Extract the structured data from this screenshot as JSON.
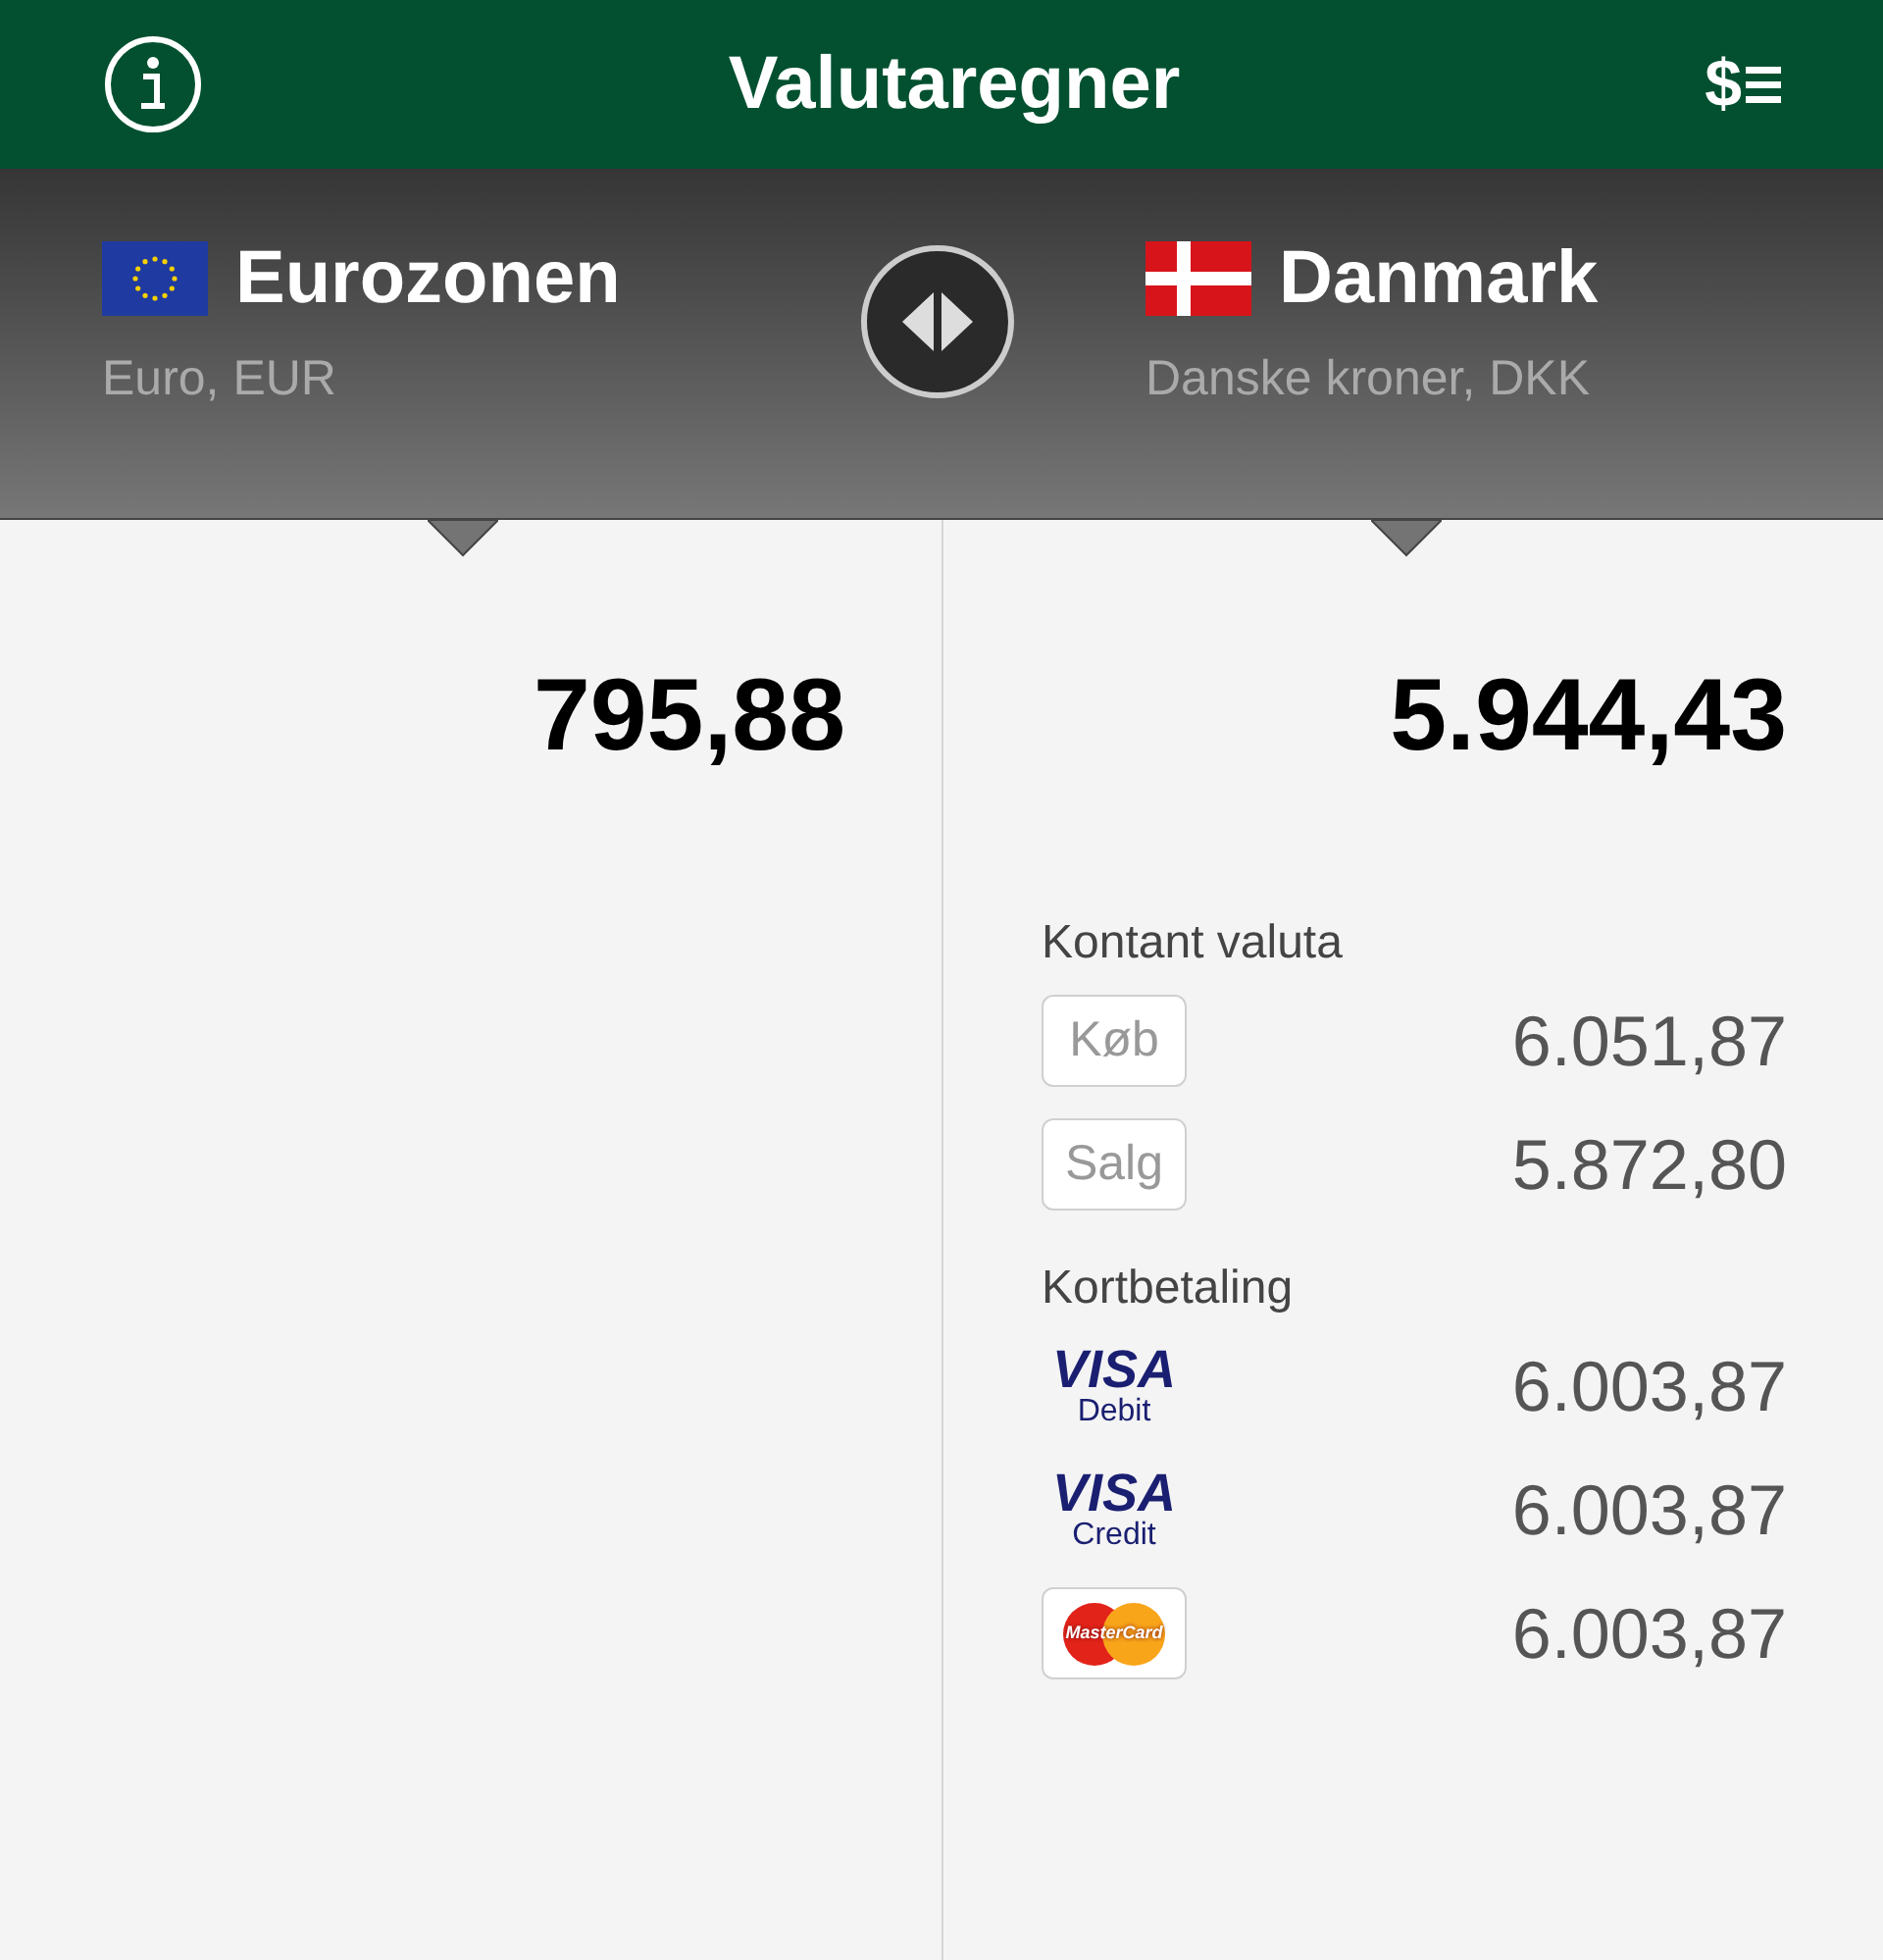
{
  "header": {
    "title": "Valutaregner",
    "menu_symbol": "$"
  },
  "from": {
    "region": "Eurozonen",
    "currency": "Euro, EUR",
    "kind": "eu",
    "amount": "795,88"
  },
  "to": {
    "region": "Danmark",
    "currency": "Danske kroner, DKK",
    "kind": "dk",
    "amount": "5.944,43"
  },
  "sections": [
    {
      "title": "Kontant valuta",
      "rows": [
        {
          "kind": "badge",
          "label": "Køb",
          "value": "6.051,87"
        },
        {
          "kind": "badge",
          "label": "Salg",
          "value": "5.872,80"
        }
      ]
    },
    {
      "title": "Kortbetaling",
      "rows": [
        {
          "kind": "visa",
          "label": "VISA",
          "sublabel": "Debit",
          "value": "6.003,87"
        },
        {
          "kind": "visa",
          "label": "VISA",
          "sublabel": "Credit",
          "value": "6.003,87"
        },
        {
          "kind": "mastercard",
          "label": "MasterCard",
          "value": "6.003,87"
        }
      ]
    }
  ]
}
